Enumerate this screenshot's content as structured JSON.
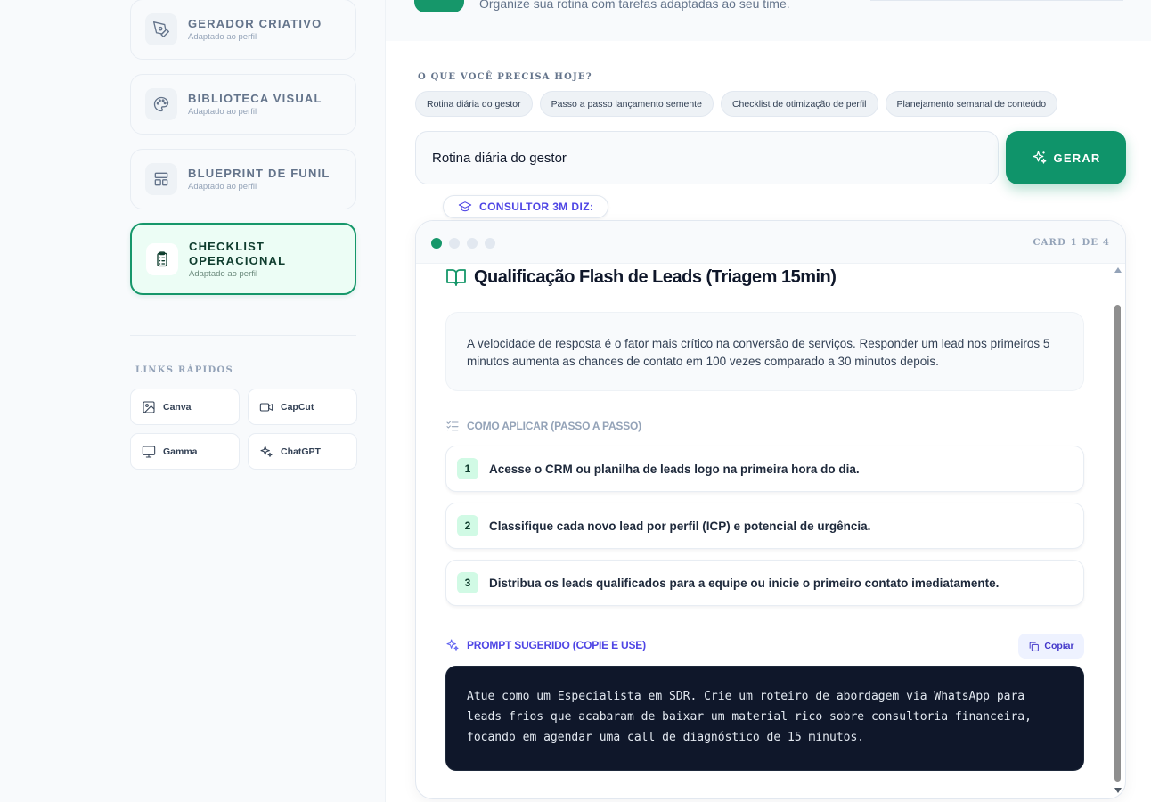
{
  "sidebar": {
    "tools": [
      {
        "title": "GERADOR CRIATIVO",
        "subtitle": "Adaptado ao perfil",
        "icon": "pen-tool-icon"
      },
      {
        "title": "BIBLIOTECA VISUAL",
        "subtitle": "Adaptado ao perfil",
        "icon": "palette-icon"
      },
      {
        "title": "BLUEPRINT DE FUNIL",
        "subtitle": "Adaptado ao perfil",
        "icon": "layout-icon"
      },
      {
        "title": "CHECKLIST OPERACIONAL",
        "subtitle": "Adaptado ao perfil",
        "icon": "clipboard-list-icon",
        "active": true
      }
    ],
    "quick_links_label": "LINKS RÁPIDOS",
    "quick_links": [
      {
        "label": "Canva",
        "icon": "image-icon"
      },
      {
        "label": "CapCut",
        "icon": "video-icon"
      },
      {
        "label": "Gamma",
        "icon": "monitor-icon"
      },
      {
        "label": "ChatGPT",
        "icon": "sparkles-icon"
      }
    ]
  },
  "header": {
    "subtitle": "Organize sua rotina com tarefas adaptadas ao seu time."
  },
  "main": {
    "need_label": "O QUE VOCÊ PRECISA HOJE?",
    "chips": [
      "Rotina diária do gestor",
      "Passo a passo lançamento semente",
      "Checklist de otimização de perfil",
      "Planejamento semanal de conteúdo"
    ],
    "input_value": "Rotina diária do gestor",
    "generate_label": "GERAR",
    "consultor_label": "CONSULTOR 3M DIZ:"
  },
  "card": {
    "counter": "CARD 1 DE 4",
    "total_cards": 4,
    "current_card": 1,
    "title": "Qualificação Flash de Leads (Triagem 15min)",
    "intro": "A velocidade de resposta é o fator mais crítico na conversão de serviços. Responder um lead nos primeiros 5 minutos aumenta as chances de contato em 100 vezes comparado a 30 minutos depois.",
    "steps_label": "COMO APLICAR (PASSO A PASSO)",
    "steps": [
      {
        "num": "1",
        "text": "Acesse o CRM ou planilha de leads logo na primeira hora do dia."
      },
      {
        "num": "2",
        "text": "Classifique cada novo lead por perfil (ICP) e potencial de urgência."
      },
      {
        "num": "3",
        "text": "Distribua os leads qualificados para a equipe ou inicie o primeiro contato imediatamente."
      }
    ],
    "prompt_label": "PROMPT SUGERIDO (COPIE E USE)",
    "copy_label": "Copiar",
    "prompt_text": "Atue como um Especialista em SDR. Crie um roteiro de abordagem via WhatsApp para leads frios que acabaram de baixar um material rico sobre consultoria financeira, focando em agendar uma call de diagnóstico de 15 minutos."
  },
  "colors": {
    "accent": "#16976a",
    "indigo": "#4f46e5",
    "dark_prompt": "#0f172a"
  }
}
